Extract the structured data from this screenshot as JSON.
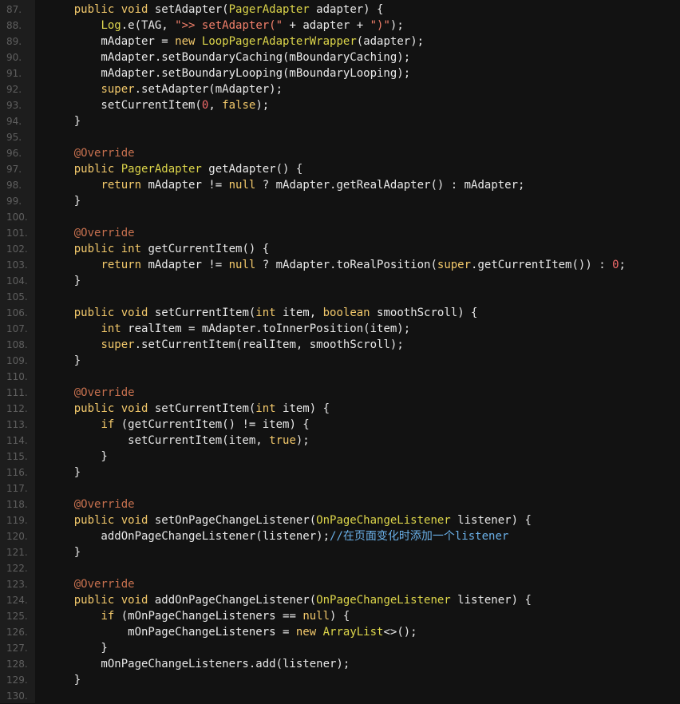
{
  "editor": {
    "theme": {
      "background": "#121212",
      "gutter": "#1d1d1d",
      "line_number": "#5f5f5f",
      "plain": "#e8e8e8",
      "keyword": "#f3c96b",
      "type": "#dcd54a",
      "string": "#f2806b",
      "number": "#f26a6a",
      "annotation": "#c6704e",
      "comment": "#6ab0e8"
    },
    "lines": [
      {
        "n": "87.",
        "t": [
          [
            "    public ",
            "kw"
          ],
          [
            "void",
            "kw"
          ],
          [
            " setAdapter(",
            "plain"
          ],
          [
            "PagerAdapter",
            "type"
          ],
          [
            " adapter) {",
            "plain"
          ]
        ]
      },
      {
        "n": "88.",
        "t": [
          [
            "        ",
            "plain"
          ],
          [
            "Log",
            "log"
          ],
          [
            ".e(TAG, ",
            "plain"
          ],
          [
            "\">> setAdapter(\"",
            "str"
          ],
          [
            " + adapter + ",
            "plain"
          ],
          [
            "\")\"",
            "str"
          ],
          [
            ");",
            "plain"
          ]
        ]
      },
      {
        "n": "89.",
        "t": [
          [
            "        mAdapter = ",
            "plain"
          ],
          [
            "new",
            "kw"
          ],
          [
            " ",
            "plain"
          ],
          [
            "LoopPagerAdapterWrapper",
            "type"
          ],
          [
            "(adapter);",
            "plain"
          ]
        ]
      },
      {
        "n": "90.",
        "t": [
          [
            "        mAdapter.setBoundaryCaching(mBoundaryCaching);",
            "plain"
          ]
        ]
      },
      {
        "n": "91.",
        "t": [
          [
            "        mAdapter.setBoundaryLooping(mBoundaryLooping);",
            "plain"
          ]
        ]
      },
      {
        "n": "92.",
        "t": [
          [
            "        ",
            "plain"
          ],
          [
            "super",
            "kw"
          ],
          [
            ".setAdapter(mAdapter);",
            "plain"
          ]
        ]
      },
      {
        "n": "93.",
        "t": [
          [
            "        setCurrentItem(",
            "plain"
          ],
          [
            "0",
            "num"
          ],
          [
            ", ",
            "plain"
          ],
          [
            "false",
            "kw"
          ],
          [
            ");",
            "plain"
          ]
        ]
      },
      {
        "n": "94.",
        "t": [
          [
            "    }",
            "plain"
          ]
        ]
      },
      {
        "n": "95.",
        "t": []
      },
      {
        "n": "96.",
        "t": [
          [
            "    ",
            "plain"
          ],
          [
            "@Override",
            "ann"
          ]
        ]
      },
      {
        "n": "97.",
        "t": [
          [
            "    public ",
            "kw"
          ],
          [
            "PagerAdapter",
            "type"
          ],
          [
            " getAdapter() {",
            "plain"
          ]
        ]
      },
      {
        "n": "98.",
        "t": [
          [
            "        ",
            "plain"
          ],
          [
            "return",
            "kw"
          ],
          [
            " mAdapter != ",
            "plain"
          ],
          [
            "null",
            "kw"
          ],
          [
            " ? mAdapter.getRealAdapter() : mAdapter;",
            "plain"
          ]
        ]
      },
      {
        "n": "99.",
        "t": [
          [
            "    }",
            "plain"
          ]
        ]
      },
      {
        "n": "100.",
        "t": []
      },
      {
        "n": "101.",
        "t": [
          [
            "    ",
            "plain"
          ],
          [
            "@Override",
            "ann"
          ]
        ]
      },
      {
        "n": "102.",
        "t": [
          [
            "    public ",
            "kw"
          ],
          [
            "int",
            "kw"
          ],
          [
            " getCurrentItem() {",
            "plain"
          ]
        ]
      },
      {
        "n": "103.",
        "t": [
          [
            "        ",
            "plain"
          ],
          [
            "return",
            "kw"
          ],
          [
            " mAdapter != ",
            "plain"
          ],
          [
            "null",
            "kw"
          ],
          [
            " ? mAdapter.toRealPosition(",
            "plain"
          ],
          [
            "super",
            "kw"
          ],
          [
            ".getCurrentItem()) : ",
            "plain"
          ],
          [
            "0",
            "num"
          ],
          [
            ";",
            "plain"
          ]
        ]
      },
      {
        "n": "104.",
        "t": [
          [
            "    }",
            "plain"
          ]
        ]
      },
      {
        "n": "105.",
        "t": []
      },
      {
        "n": "106.",
        "t": [
          [
            "    public ",
            "kw"
          ],
          [
            "void",
            "kw"
          ],
          [
            " setCurrentItem(",
            "plain"
          ],
          [
            "int",
            "kw"
          ],
          [
            " item, ",
            "plain"
          ],
          [
            "boolean",
            "kw"
          ],
          [
            " smoothScroll) {",
            "plain"
          ]
        ]
      },
      {
        "n": "107.",
        "t": [
          [
            "        ",
            "plain"
          ],
          [
            "int",
            "kw"
          ],
          [
            " realItem = mAdapter.toInnerPosition(item);",
            "plain"
          ]
        ]
      },
      {
        "n": "108.",
        "t": [
          [
            "        ",
            "plain"
          ],
          [
            "super",
            "kw"
          ],
          [
            ".setCurrentItem(realItem, smoothScroll);",
            "plain"
          ]
        ]
      },
      {
        "n": "109.",
        "t": [
          [
            "    }",
            "plain"
          ]
        ]
      },
      {
        "n": "110.",
        "t": []
      },
      {
        "n": "111.",
        "t": [
          [
            "    ",
            "plain"
          ],
          [
            "@Override",
            "ann"
          ]
        ]
      },
      {
        "n": "112.",
        "t": [
          [
            "    public ",
            "kw"
          ],
          [
            "void",
            "kw"
          ],
          [
            " setCurrentItem(",
            "plain"
          ],
          [
            "int",
            "kw"
          ],
          [
            " item) {",
            "plain"
          ]
        ]
      },
      {
        "n": "113.",
        "t": [
          [
            "        ",
            "plain"
          ],
          [
            "if",
            "kw"
          ],
          [
            " (getCurrentItem() != item) {",
            "plain"
          ]
        ]
      },
      {
        "n": "114.",
        "t": [
          [
            "            setCurrentItem(item, ",
            "plain"
          ],
          [
            "true",
            "kw"
          ],
          [
            ");",
            "plain"
          ]
        ]
      },
      {
        "n": "115.",
        "t": [
          [
            "        }",
            "plain"
          ]
        ]
      },
      {
        "n": "116.",
        "t": [
          [
            "    }",
            "plain"
          ]
        ]
      },
      {
        "n": "117.",
        "t": []
      },
      {
        "n": "118.",
        "t": [
          [
            "    ",
            "plain"
          ],
          [
            "@Override",
            "ann"
          ]
        ]
      },
      {
        "n": "119.",
        "t": [
          [
            "    public ",
            "kw"
          ],
          [
            "void",
            "kw"
          ],
          [
            " setOnPageChangeListener(",
            "plain"
          ],
          [
            "OnPageChangeListener",
            "type"
          ],
          [
            " listener) {",
            "plain"
          ]
        ]
      },
      {
        "n": "120.",
        "t": [
          [
            "        addOnPageChangeListener(listener);",
            "plain"
          ],
          [
            "//在页面变化时添加一个listener",
            "com"
          ]
        ]
      },
      {
        "n": "121.",
        "t": [
          [
            "    }",
            "plain"
          ]
        ]
      },
      {
        "n": "122.",
        "t": []
      },
      {
        "n": "123.",
        "t": [
          [
            "    ",
            "plain"
          ],
          [
            "@Override",
            "ann"
          ]
        ]
      },
      {
        "n": "124.",
        "t": [
          [
            "    public ",
            "kw"
          ],
          [
            "void",
            "kw"
          ],
          [
            " addOnPageChangeListener(",
            "plain"
          ],
          [
            "OnPageChangeListener",
            "type"
          ],
          [
            " listener) {",
            "plain"
          ]
        ]
      },
      {
        "n": "125.",
        "t": [
          [
            "        ",
            "plain"
          ],
          [
            "if",
            "kw"
          ],
          [
            " (mOnPageChangeListeners == ",
            "plain"
          ],
          [
            "null",
            "kw"
          ],
          [
            ") {",
            "plain"
          ]
        ]
      },
      {
        "n": "126.",
        "t": [
          [
            "            mOnPageChangeListeners = ",
            "plain"
          ],
          [
            "new",
            "kw"
          ],
          [
            " ",
            "plain"
          ],
          [
            "ArrayList",
            "type"
          ],
          [
            "<>();",
            "plain"
          ]
        ]
      },
      {
        "n": "127.",
        "t": [
          [
            "        }",
            "plain"
          ]
        ]
      },
      {
        "n": "128.",
        "t": [
          [
            "        mOnPageChangeListeners.add(listener);",
            "plain"
          ]
        ]
      },
      {
        "n": "129.",
        "t": [
          [
            "    }",
            "plain"
          ]
        ]
      },
      {
        "n": "130.",
        "t": []
      }
    ]
  }
}
